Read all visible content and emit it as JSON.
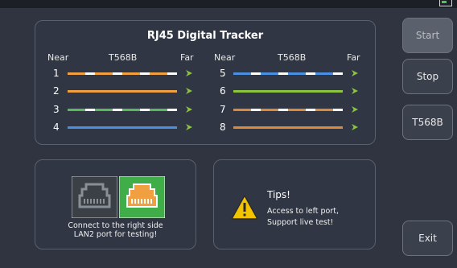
{
  "title": "RJ45  Digital Tracker",
  "headers": {
    "near_left": "Near",
    "std_left": "T568B",
    "far_left": "Far",
    "near_right": "Near",
    "std_right": "T568B",
    "far_right": "Far"
  },
  "pins": [
    {
      "num": "1",
      "stripe": "#f0a040",
      "base": "#ffffff",
      "striped": true
    },
    {
      "num": "2",
      "stripe": "#f0a040",
      "base": "#f0a040",
      "striped": false
    },
    {
      "num": "3",
      "stripe": "#5cb85c",
      "base": "#ffffff",
      "striped": true
    },
    {
      "num": "4",
      "stripe": "#4a8fe0",
      "base": "#4a8fe0",
      "striped": false
    },
    {
      "num": "5",
      "stripe": "#4a8fe0",
      "base": "#ffffff",
      "striped": true
    },
    {
      "num": "6",
      "stripe": "#8cc63f",
      "base": "#8cc63f",
      "striped": false
    },
    {
      "num": "7",
      "stripe": "#d98a3a",
      "base": "#ffffff",
      "striped": true
    },
    {
      "num": "8",
      "stripe": "#d98a3a",
      "base": "#d98a3a",
      "striped": false
    }
  ],
  "port": {
    "caption_line1": "Connect to the right side",
    "caption_line2": "LAN2 port for testing!",
    "active_color": "#3fae49",
    "inactive_color": "#3b3f46"
  },
  "tips": {
    "title": "Tips!",
    "line1": "Access to left port,",
    "line2": "Support live test!"
  },
  "buttons": {
    "start": "Start",
    "stop": "Stop",
    "standard": "T568B",
    "exit": "Exit"
  },
  "colors": {
    "far_icon": "#8cc63f",
    "warning": "#f2c400"
  }
}
